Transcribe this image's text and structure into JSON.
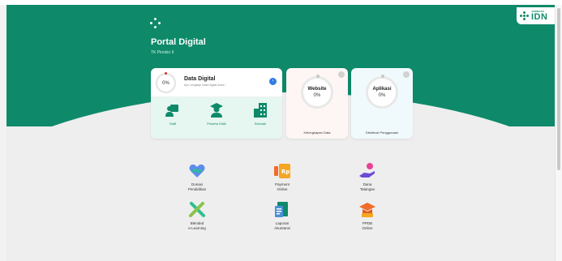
{
  "brand": {
    "small": "JARINGAN",
    "big": "IDN"
  },
  "header": {
    "title": "Portal Digital",
    "subtitle": "TK Pinokio II"
  },
  "data_digital": {
    "percent": "0%",
    "title": "Data Digital",
    "subtitle": "Ayo Lengkapi Data Digital Anda !",
    "items": [
      {
        "label": "Staff"
      },
      {
        "label": "Peserta Didik"
      },
      {
        "label": "Sekolah"
      }
    ]
  },
  "website": {
    "title": "Website",
    "value": "0%",
    "caption": "Kelengkapan Data"
  },
  "aplikasi": {
    "title": "Aplikasi",
    "value": "0%",
    "caption": "Distribusi Penggunaan"
  },
  "menu": [
    {
      "line1": "Donasi",
      "line2": "Pendidikan"
    },
    {
      "line1": "Payment",
      "line2": "Online"
    },
    {
      "line1": "Dana",
      "line2": "Talangan"
    },
    {
      "line1": "Blended",
      "line2": "e-Learning"
    },
    {
      "line1": "Laporan",
      "line2": "Akuntansi"
    },
    {
      "line1": "PPDB",
      "line2": "Online"
    }
  ],
  "colors": {
    "primary": "#0e8a6a",
    "accent_blue": "#2f7be5",
    "orange": "#f5a623"
  }
}
